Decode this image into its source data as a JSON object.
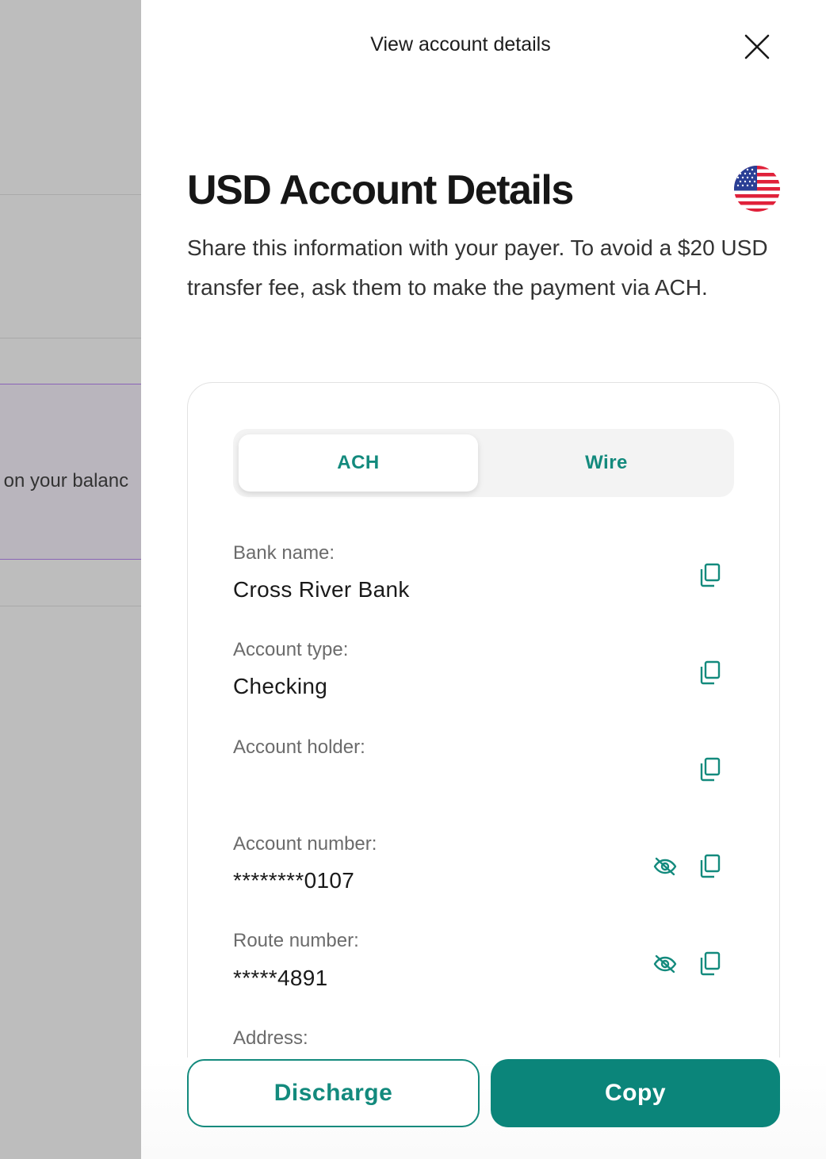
{
  "background": {
    "notice_text": "y on your balanc"
  },
  "drawer": {
    "header_title": "View account details",
    "title": "USD Account Details",
    "flag_icon": "us-flag-icon",
    "description": "Share this information with your payer. To avoid a $20 USD transfer fee, ask them to make the payment via ACH.",
    "tabs": [
      {
        "label": "ACH",
        "selected": true
      },
      {
        "label": "Wire",
        "selected": false
      }
    ],
    "fields": [
      {
        "label": "Bank name:",
        "value": "Cross River Bank",
        "masked": false
      },
      {
        "label": "Account type:",
        "value": "Checking",
        "masked": false
      },
      {
        "label": "Account holder:",
        "value": "",
        "masked": false
      },
      {
        "label": "Account number:",
        "value": "********0107",
        "masked": true
      },
      {
        "label": "Route number:",
        "value": "*****4891",
        "masked": true
      },
      {
        "label": "Address:",
        "value": "",
        "masked": false
      }
    ],
    "buttons": {
      "discharge_label": "Discharge",
      "copy_label": "Copy"
    }
  },
  "colors": {
    "accent": "#138a7d",
    "primary_button": "#0b857a",
    "overlay": "#bdbdbd",
    "notice_border": "#8a64b8"
  }
}
